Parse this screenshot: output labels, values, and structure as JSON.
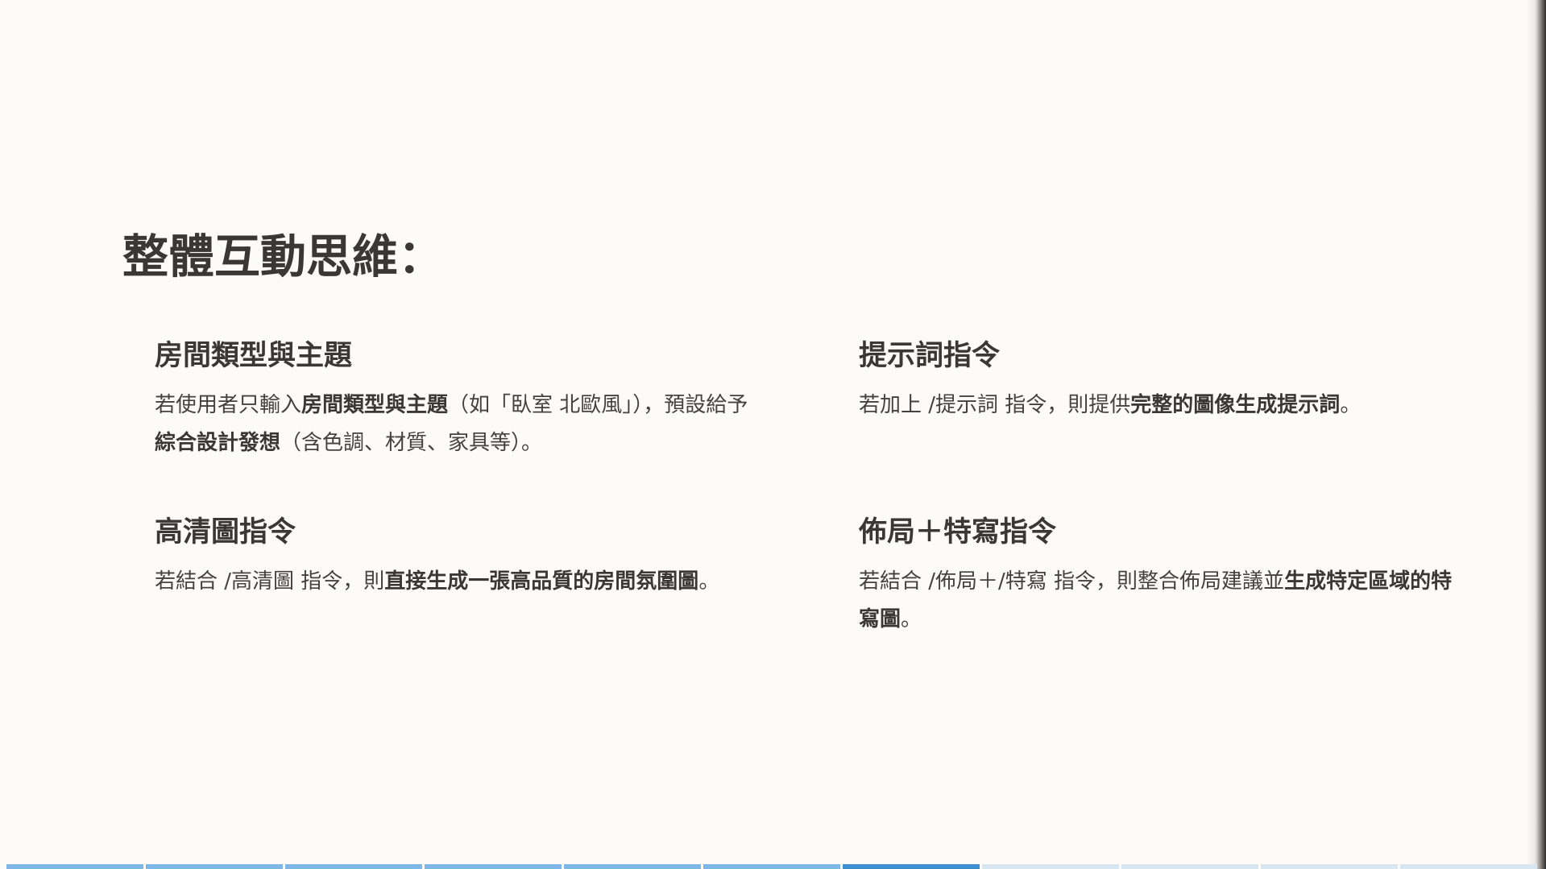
{
  "slide": {
    "title": "整體互動思維：",
    "cards": [
      {
        "heading": "房間類型與主題",
        "parts": [
          {
            "t": "若使用者只輸入",
            "b": false
          },
          {
            "t": "房間類型與主題",
            "b": true
          },
          {
            "t": "（如「臥室 北歐風」），預設給予",
            "b": false
          },
          {
            "t": "綜合設計發想",
            "b": true
          },
          {
            "t": "（含色調、材質、家具等）。",
            "b": false
          }
        ]
      },
      {
        "heading": "提示詞指令",
        "parts": [
          {
            "t": "若加上 /提示詞 指令，則提供",
            "b": false
          },
          {
            "t": "完整的圖像生成提示詞",
            "b": true
          },
          {
            "t": "。",
            "b": false
          }
        ]
      },
      {
        "heading": "高清圖指令",
        "parts": [
          {
            "t": "若結合 /高清圖 指令，則",
            "b": false
          },
          {
            "t": "直接生成一張高品質的房間氛圍圖",
            "b": true
          },
          {
            "t": "。",
            "b": false
          }
        ]
      },
      {
        "heading": "佈局＋特寫指令",
        "parts": [
          {
            "t": "若結合 /佈局＋/特寫 指令，則整合佈局建議並",
            "b": false
          },
          {
            "t": "生成特定區域的特寫圖",
            "b": true
          },
          {
            "t": "。",
            "b": false
          }
        ]
      }
    ]
  },
  "progress": {
    "total_segments": 11,
    "current_segment": 7,
    "colors": {
      "completed": "#7fb8e8",
      "current": "#3e8fd6",
      "upcoming": "#d8e6f2"
    }
  },
  "colors": {
    "background": "#fdfbf8",
    "text": "#3a3734"
  }
}
